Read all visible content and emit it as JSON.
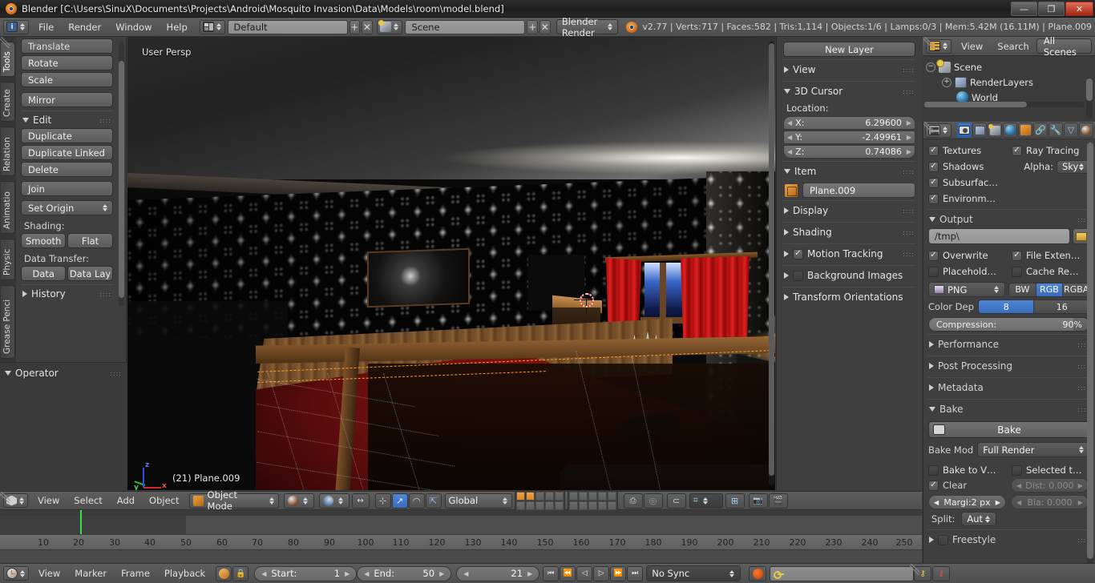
{
  "window": {
    "title": "Blender [C:\\Users\\SinuX\\Documents\\Projects\\Android\\Mosquito Invasion\\Data\\Models\\room\\model.blend]",
    "minimize": "—",
    "maximize": "❐",
    "close": "✕"
  },
  "topbar": {
    "menus": [
      "File",
      "Render",
      "Window",
      "Help"
    ],
    "screen_layout": "Default",
    "scene_name": "Scene",
    "engine": "Blender Render",
    "add_icon": "+",
    "remove_icon": "✕",
    "status": "v2.77 | Verts:717 | Faces:582 | Tris:1,114 | Objects:1/6 | Lamps:0/3 | Mem:5.42M (16.11M) | Plane.009"
  },
  "toolshelf": {
    "tabs": [
      "Tools",
      "Create",
      "Relation",
      "Animatio",
      "Physic",
      "Grease Penci"
    ],
    "active_tab": "Tools",
    "transform_buttons": [
      "Translate",
      "Rotate",
      "Scale",
      "Mirror"
    ],
    "edit_section": "Edit",
    "edit_buttons": [
      "Duplicate",
      "Duplicate Linked",
      "Delete",
      "Join"
    ],
    "set_origin": "Set Origin",
    "shading_label": "Shading:",
    "shading_buttons": [
      "Smooth",
      "Flat"
    ],
    "data_transfer_label": "Data Transfer:",
    "data_buttons": [
      "Data",
      "Data Lay"
    ],
    "history_section": "History",
    "operator_section": "Operator"
  },
  "viewport": {
    "view_label": "User Persp",
    "object_label": "(21) Plane.009",
    "axis": {
      "x": "x",
      "y": "y",
      "z": "z"
    }
  },
  "npanel": {
    "new_layer": "New Layer",
    "sections": [
      {
        "name": "View",
        "open": false
      },
      {
        "name": "3D Cursor",
        "open": true
      },
      {
        "name": "Item",
        "open": true
      },
      {
        "name": "Display",
        "open": false
      },
      {
        "name": "Shading",
        "open": false
      },
      {
        "name": "Motion Tracking",
        "open": false,
        "checkbox": true
      },
      {
        "name": "Background Images",
        "open": false,
        "checkbox": false
      },
      {
        "name": "Transform Orientations",
        "open": false
      }
    ],
    "cursor_location_label": "Location:",
    "cursor": [
      {
        "axis": "X:",
        "value": "6.29600"
      },
      {
        "axis": "Y:",
        "value": "-2.49961"
      },
      {
        "axis": "Z:",
        "value": "0.74086"
      }
    ],
    "item_name": "Plane.009"
  },
  "outliner": {
    "menus": [
      "View",
      "Search"
    ],
    "display_mode": "All Scenes",
    "rows": [
      {
        "label": "Scene",
        "indent": 0,
        "expander": "−",
        "icon": "scene-icon"
      },
      {
        "label": "RenderLayers",
        "indent": 1,
        "expander": "+",
        "icon": "renderlayers-icon"
      },
      {
        "label": "World",
        "indent": 2,
        "expander": "",
        "icon": "world-icon"
      }
    ]
  },
  "properties": {
    "tabs": [
      "render-tab",
      "renderlayers-tab",
      "scene-tab",
      "world-tab",
      "object-tab",
      "constraints-tab",
      "modifiers-tab",
      "data-tab",
      "material-tab"
    ],
    "active_tab": "render-tab",
    "shading": {
      "items": [
        {
          "label": "Textures",
          "checked": true
        },
        {
          "label": "Ray Tracing",
          "checked": true
        },
        {
          "label": "Shadows",
          "checked": true
        },
        {
          "label": "Subsurfac…",
          "checked": true
        },
        {
          "label": "Environm…",
          "checked": true
        }
      ],
      "alpha_label": "Alpha:",
      "alpha_value": "Sky"
    },
    "output": {
      "title": "Output",
      "path": "/tmp\\",
      "toggles": [
        {
          "label": "Overwrite",
          "checked": true
        },
        {
          "label": "File Exten…",
          "checked": true
        },
        {
          "label": "Placehold…",
          "checked": false
        },
        {
          "label": "Cache Re…",
          "checked": false
        }
      ],
      "format": "PNG",
      "color_modes": [
        "BW",
        "RGB",
        "RGBA"
      ],
      "color_mode_active": "RGB",
      "color_depth_label": "Color Dep",
      "color_depths": [
        "8",
        "16"
      ],
      "color_depth_active": "8",
      "compression_label": "Compression:",
      "compression_value": "90%",
      "compression_pct": 90
    },
    "collapsed_sections": [
      "Performance",
      "Post Processing",
      "Metadata"
    ],
    "bake": {
      "title": "Bake",
      "button": "Bake",
      "mode_label": "Bake Mod",
      "mode_value": "Full Render",
      "toggles": [
        {
          "label": "Bake to V…",
          "checked": false
        },
        {
          "label": "Selected t…",
          "checked": false
        }
      ],
      "clear_label": "Clear",
      "clear_checked": true,
      "dist_label": "Dist: 0.000",
      "margin_label": "Margi:2 px",
      "bias_label": "Bia: 0.000",
      "split_label": "Split:",
      "split_value": "Aut"
    },
    "freestyle": {
      "label": "Freestyle",
      "checked": false
    }
  },
  "viewport_footer": {
    "menus": [
      "View",
      "Select",
      "Add",
      "Object"
    ],
    "mode": "Object Mode",
    "transform_orientation": "Global",
    "pivot_icon": "pivot-icon",
    "snap_icon": "magnet-icon",
    "manipulator_icons": [
      "translate-manipulator",
      "rotate-manipulator",
      "scale-manipulator"
    ],
    "layers_on": [
      0,
      1
    ]
  },
  "timeline": {
    "menus": [
      "View",
      "Marker",
      "Frame",
      "Playback"
    ],
    "start_label": "Start:",
    "start_value": "1",
    "end_label": "End:",
    "end_value": "50",
    "current_frame": "21",
    "sync_mode": "No Sync",
    "ticks": [
      10,
      20,
      30,
      40,
      50,
      60,
      70,
      80,
      90,
      100,
      110,
      120,
      130,
      140,
      150,
      160,
      170,
      180,
      190,
      200,
      210,
      220,
      230,
      240,
      250
    ],
    "transport": [
      "⏮",
      "⏪",
      "◁",
      "▷",
      "⏩",
      "⏭"
    ]
  },
  "colors": {
    "accent_blue": "#3b78c8",
    "accent_orange": "#f0a33e",
    "header_gray": "#5d5d5d",
    "panel_gray": "#3f3f3f",
    "playhead_green": "#35e04a"
  }
}
